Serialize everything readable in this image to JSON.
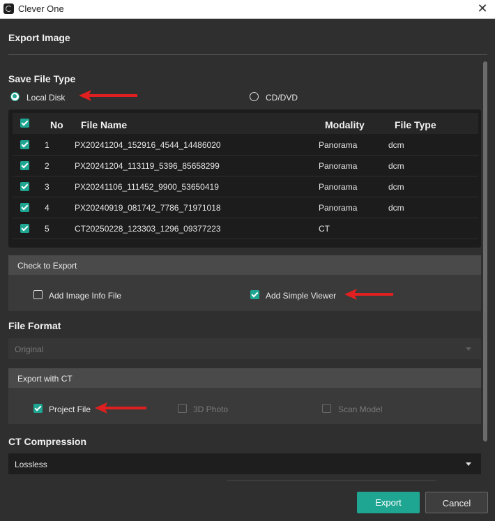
{
  "window": {
    "title": "Clever One"
  },
  "heading": "Export Image",
  "save_file_type": {
    "title": "Save File Type",
    "options": [
      {
        "label": "Local Disk",
        "selected": true
      },
      {
        "label": "CD/DVD",
        "selected": false
      }
    ]
  },
  "table": {
    "columns": [
      "No",
      "File Name",
      "Modality",
      "File Type"
    ],
    "header_checked": true,
    "rows": [
      {
        "checked": true,
        "no": "1",
        "file_name": "PX20241204_152916_4544_14486020",
        "modality": "Panorama",
        "file_type": "dcm"
      },
      {
        "checked": true,
        "no": "2",
        "file_name": "PX20241204_113119_5396_85658299",
        "modality": "Panorama",
        "file_type": "dcm"
      },
      {
        "checked": true,
        "no": "3",
        "file_name": "PX20241106_111452_9900_53650419",
        "modality": "Panorama",
        "file_type": "dcm"
      },
      {
        "checked": true,
        "no": "4",
        "file_name": "PX20240919_081742_7786_71971018",
        "modality": "Panorama",
        "file_type": "dcm"
      },
      {
        "checked": true,
        "no": "5",
        "file_name": "CT20250228_123303_1296_09377223",
        "modality": "CT",
        "file_type": ""
      }
    ]
  },
  "check_to_export": {
    "title": "Check to Export",
    "add_image_info": {
      "label": "Add Image Info File",
      "checked": false
    },
    "add_simple_viewer": {
      "label": "Add Simple Viewer",
      "checked": true
    }
  },
  "file_format": {
    "title": "File Format",
    "value": "Original",
    "enabled": false
  },
  "export_with_ct": {
    "title": "Export with CT",
    "project_file": {
      "label": "Project File",
      "checked": true,
      "enabled": true
    },
    "photo_3d": {
      "label": "3D Photo",
      "checked": false,
      "enabled": false
    },
    "scan_model": {
      "label": "Scan Model",
      "checked": false,
      "enabled": false
    }
  },
  "ct_compression": {
    "title": "CT Compression",
    "value": "Lossless"
  },
  "buttons": {
    "export": "Export",
    "cancel": "Cancel"
  },
  "colors": {
    "accent": "#1fa692",
    "arrow": "#e02020",
    "background": "#2f2f2f"
  },
  "icons": {
    "app": "app-logo-icon",
    "close": "close-icon",
    "dropdown": "chevron-down-icon",
    "annotation": "red-arrow-icon"
  }
}
